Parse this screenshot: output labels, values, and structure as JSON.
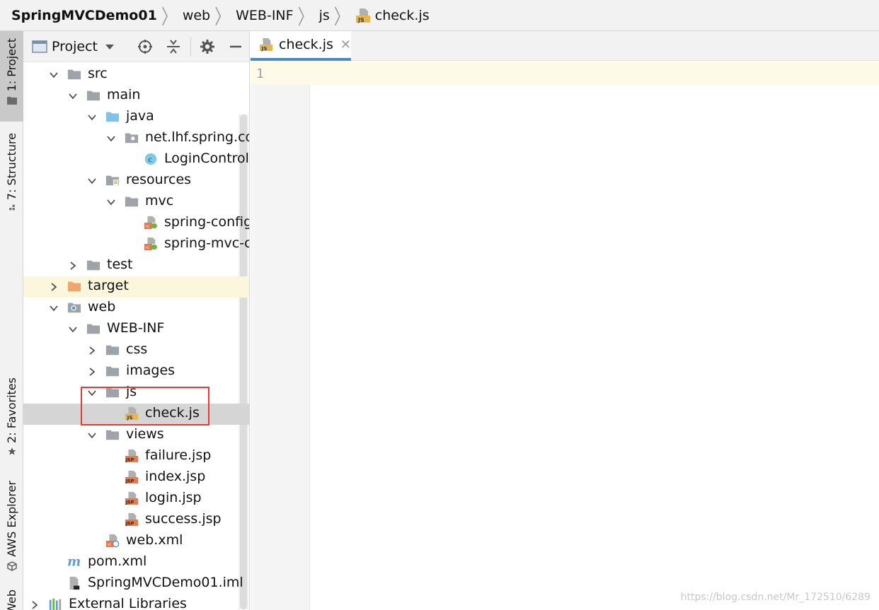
{
  "breadcrumb": {
    "items": [
      "SpringMVCDemo01",
      "web",
      "WEB-INF",
      "js",
      "check.js"
    ]
  },
  "left_strip": {
    "project_tab": "1: Project",
    "structure_tab": "7: Structure",
    "favorites_tab": "2: Favorites",
    "aws_tab": "AWS Explorer",
    "web_tab": "Web"
  },
  "project_panel": {
    "title": "Project"
  },
  "tree": [
    {
      "label": "src",
      "depth": 0,
      "arrow": "down",
      "icon": "folder-icon"
    },
    {
      "label": "main",
      "depth": 1,
      "arrow": "down",
      "icon": "folder-icon"
    },
    {
      "label": "java",
      "depth": 2,
      "arrow": "down",
      "icon": "source-folder-icon"
    },
    {
      "label": "net.lhf.spring.con",
      "depth": 3,
      "arrow": "down",
      "icon": "package-icon"
    },
    {
      "label": "LoginControlle",
      "depth": 4,
      "arrow": "",
      "icon": "class-icon"
    },
    {
      "label": "resources",
      "depth": 2,
      "arrow": "down",
      "icon": "resources-folder-icon"
    },
    {
      "label": "mvc",
      "depth": 3,
      "arrow": "down",
      "icon": "folder-icon"
    },
    {
      "label": "spring-config.",
      "depth": 4,
      "arrow": "",
      "icon": "spring-xml-icon"
    },
    {
      "label": "spring-mvc-cc",
      "depth": 4,
      "arrow": "",
      "icon": "spring-xml-icon"
    },
    {
      "label": "test",
      "depth": 1,
      "arrow": "right",
      "icon": "folder-icon"
    },
    {
      "label": "target",
      "depth": 0,
      "arrow": "right",
      "icon": "excluded-folder-icon"
    },
    {
      "label": "web",
      "depth": 0,
      "arrow": "down",
      "icon": "web-folder-icon"
    },
    {
      "label": "WEB-INF",
      "depth": 1,
      "arrow": "down",
      "icon": "folder-icon"
    },
    {
      "label": "css",
      "depth": 2,
      "arrow": "right",
      "icon": "folder-icon"
    },
    {
      "label": "images",
      "depth": 2,
      "arrow": "right",
      "icon": "folder-icon"
    },
    {
      "label": "js",
      "depth": 2,
      "arrow": "down",
      "icon": "folder-icon"
    },
    {
      "label": "check.js",
      "depth": 3,
      "arrow": "",
      "icon": "js-file-icon"
    },
    {
      "label": "views",
      "depth": 2,
      "arrow": "down",
      "icon": "folder-icon"
    },
    {
      "label": "failure.jsp",
      "depth": 3,
      "arrow": "",
      "icon": "jsp-file-icon"
    },
    {
      "label": "index.jsp",
      "depth": 3,
      "arrow": "",
      "icon": "jsp-file-icon"
    },
    {
      "label": "login.jsp",
      "depth": 3,
      "arrow": "",
      "icon": "jsp-file-icon"
    },
    {
      "label": "success.jsp",
      "depth": 3,
      "arrow": "",
      "icon": "jsp-file-icon"
    },
    {
      "label": "web.xml",
      "depth": 2,
      "arrow": "",
      "icon": "web-xml-icon"
    },
    {
      "label": "pom.xml",
      "depth": 0,
      "arrow": "",
      "icon": "maven-icon"
    },
    {
      "label": "SpringMVCDemo01.iml",
      "depth": 0,
      "arrow": "",
      "icon": "iml-file-icon"
    },
    {
      "label": "External Libraries",
      "depth": -1,
      "arrow": "right",
      "icon": "libraries-icon"
    }
  ],
  "editor": {
    "tab_label": "check.js",
    "line_numbers": [
      "1"
    ]
  },
  "watermark": "https://blog.csdn.net/Mr_172510/6289"
}
